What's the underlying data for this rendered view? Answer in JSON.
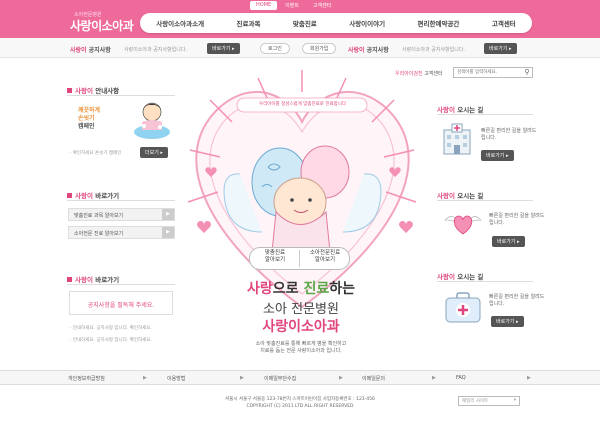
{
  "header": {
    "util_links": [
      "HOME",
      "이벤트",
      "고객센터"
    ],
    "logo_sub": "소아전문병원",
    "logo": "사랑이소아과",
    "nav": [
      "사랑이소아과소개",
      "진료과목",
      "맞춤진료",
      "사랑이이야기",
      "편리한예약공간",
      "고객센터"
    ]
  },
  "notice": {
    "left_title_accent": "사랑이",
    "left_title": " 공지사항",
    "left_text": "사랑이소아과 공지사항입니다.",
    "left_btn": "바로가기 ▸",
    "login": "로그인",
    "join": "회원가입",
    "right_title_accent": "사랑이",
    "right_title": " 공지사항",
    "right_text": "사랑이소아과 공지사항입니다.",
    "right_btn": "바로가기 ▸"
  },
  "search": {
    "label_accent": "우리아이검진",
    "label": " 고객센터",
    "placeholder": "검색어를 입력하세요."
  },
  "left": {
    "guide_title_accent": "사랑이",
    "guide_title": " 안내사항",
    "guide_lines": [
      "깨끗하게",
      "손씻기",
      "캠페인"
    ],
    "guide_bullet": "· 확인하세요 손씻기 캠페인",
    "guide_more": "더보기 ▸",
    "shortcut1_title_accent": "사랑이",
    "shortcut1_title": " 바로가기",
    "shortcut1_links": [
      "맞춤진료 과목 알아보기",
      "소아전문 진료 알아보기"
    ],
    "shortcut2_title_accent": "사랑이",
    "shortcut2_title": " 바로가기",
    "notice_box": "공지사항을 필독해 주세요.",
    "bullets": [
      "· 안내하세요. 공지사항 입니다. 확인하세요.",
      "· 안내하세요. 공지사항 입니다. 확인하세요."
    ]
  },
  "hero": {
    "bubble": "우리아이를 정성스럽게 맞춤진료로 진료합니다",
    "btn1": [
      "맞춤진료",
      "알아보기"
    ],
    "btn2": [
      "소아전문진료",
      "알아보기"
    ],
    "head1_a": "사랑",
    "head1_b": "으로 ",
    "head1_c": "진료",
    "head1_d": "하는",
    "head2": "소아 전문병원",
    "head3": "사랑이소아과",
    "desc1": "소아 맞춤진료를 통해 빠르게 병을 확인하고",
    "desc2": "치료를 돕는 전문 사랑이소아과 입니다."
  },
  "right": {
    "blocks": [
      {
        "title_accent": "사랑이",
        "title": " 오시는 길",
        "text": "빠른길 편리한 길을 알려드립니다.",
        "btn": "바로가기 ▸"
      },
      {
        "title_accent": "사랑이",
        "title": " 오시는 길",
        "text": "빠른길 편리한 길을 알려드립니다.",
        "btn": "바로가기 ▸"
      },
      {
        "title_accent": "사랑이",
        "title": " 오시는 길",
        "text": "빠른길 편리한 길을 알려드립니다.",
        "btn": "바로가기 ▸"
      }
    ]
  },
  "bottom": {
    "links": [
      "개인정보취급방침",
      "이용방법",
      "이메일무단수집",
      "이메일문의",
      "FAQ"
    ]
  },
  "footer": {
    "address": "서울시 서울구 서울동 123-78번지 스마트어린이집 사업자등록번호 : 123-456",
    "copyright": "COPYRIGHT (C) 2011 LTD ALL RIGHT RESERVED",
    "family": "패밀리 사이트"
  },
  "colors": {
    "accent": "#e0457e",
    "header": "#ee6a9b"
  }
}
